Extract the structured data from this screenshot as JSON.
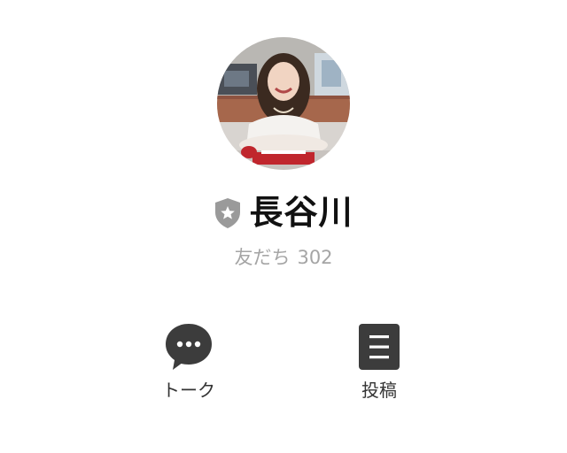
{
  "profile": {
    "name": "長谷川",
    "friends_label": "友だち",
    "friends_count": "302",
    "badge_icon": "official-shield-star-icon",
    "avatar": "profile-photo"
  },
  "actions": [
    {
      "label": "トーク",
      "icon": "speech-bubble-icon"
    },
    {
      "label": "投稿",
      "icon": "posts-list-icon"
    }
  ],
  "colors": {
    "name": "#111111",
    "subtext": "#a5a5a5",
    "icon_dark": "#3c3c3c",
    "badge": "#9a9a9a"
  }
}
